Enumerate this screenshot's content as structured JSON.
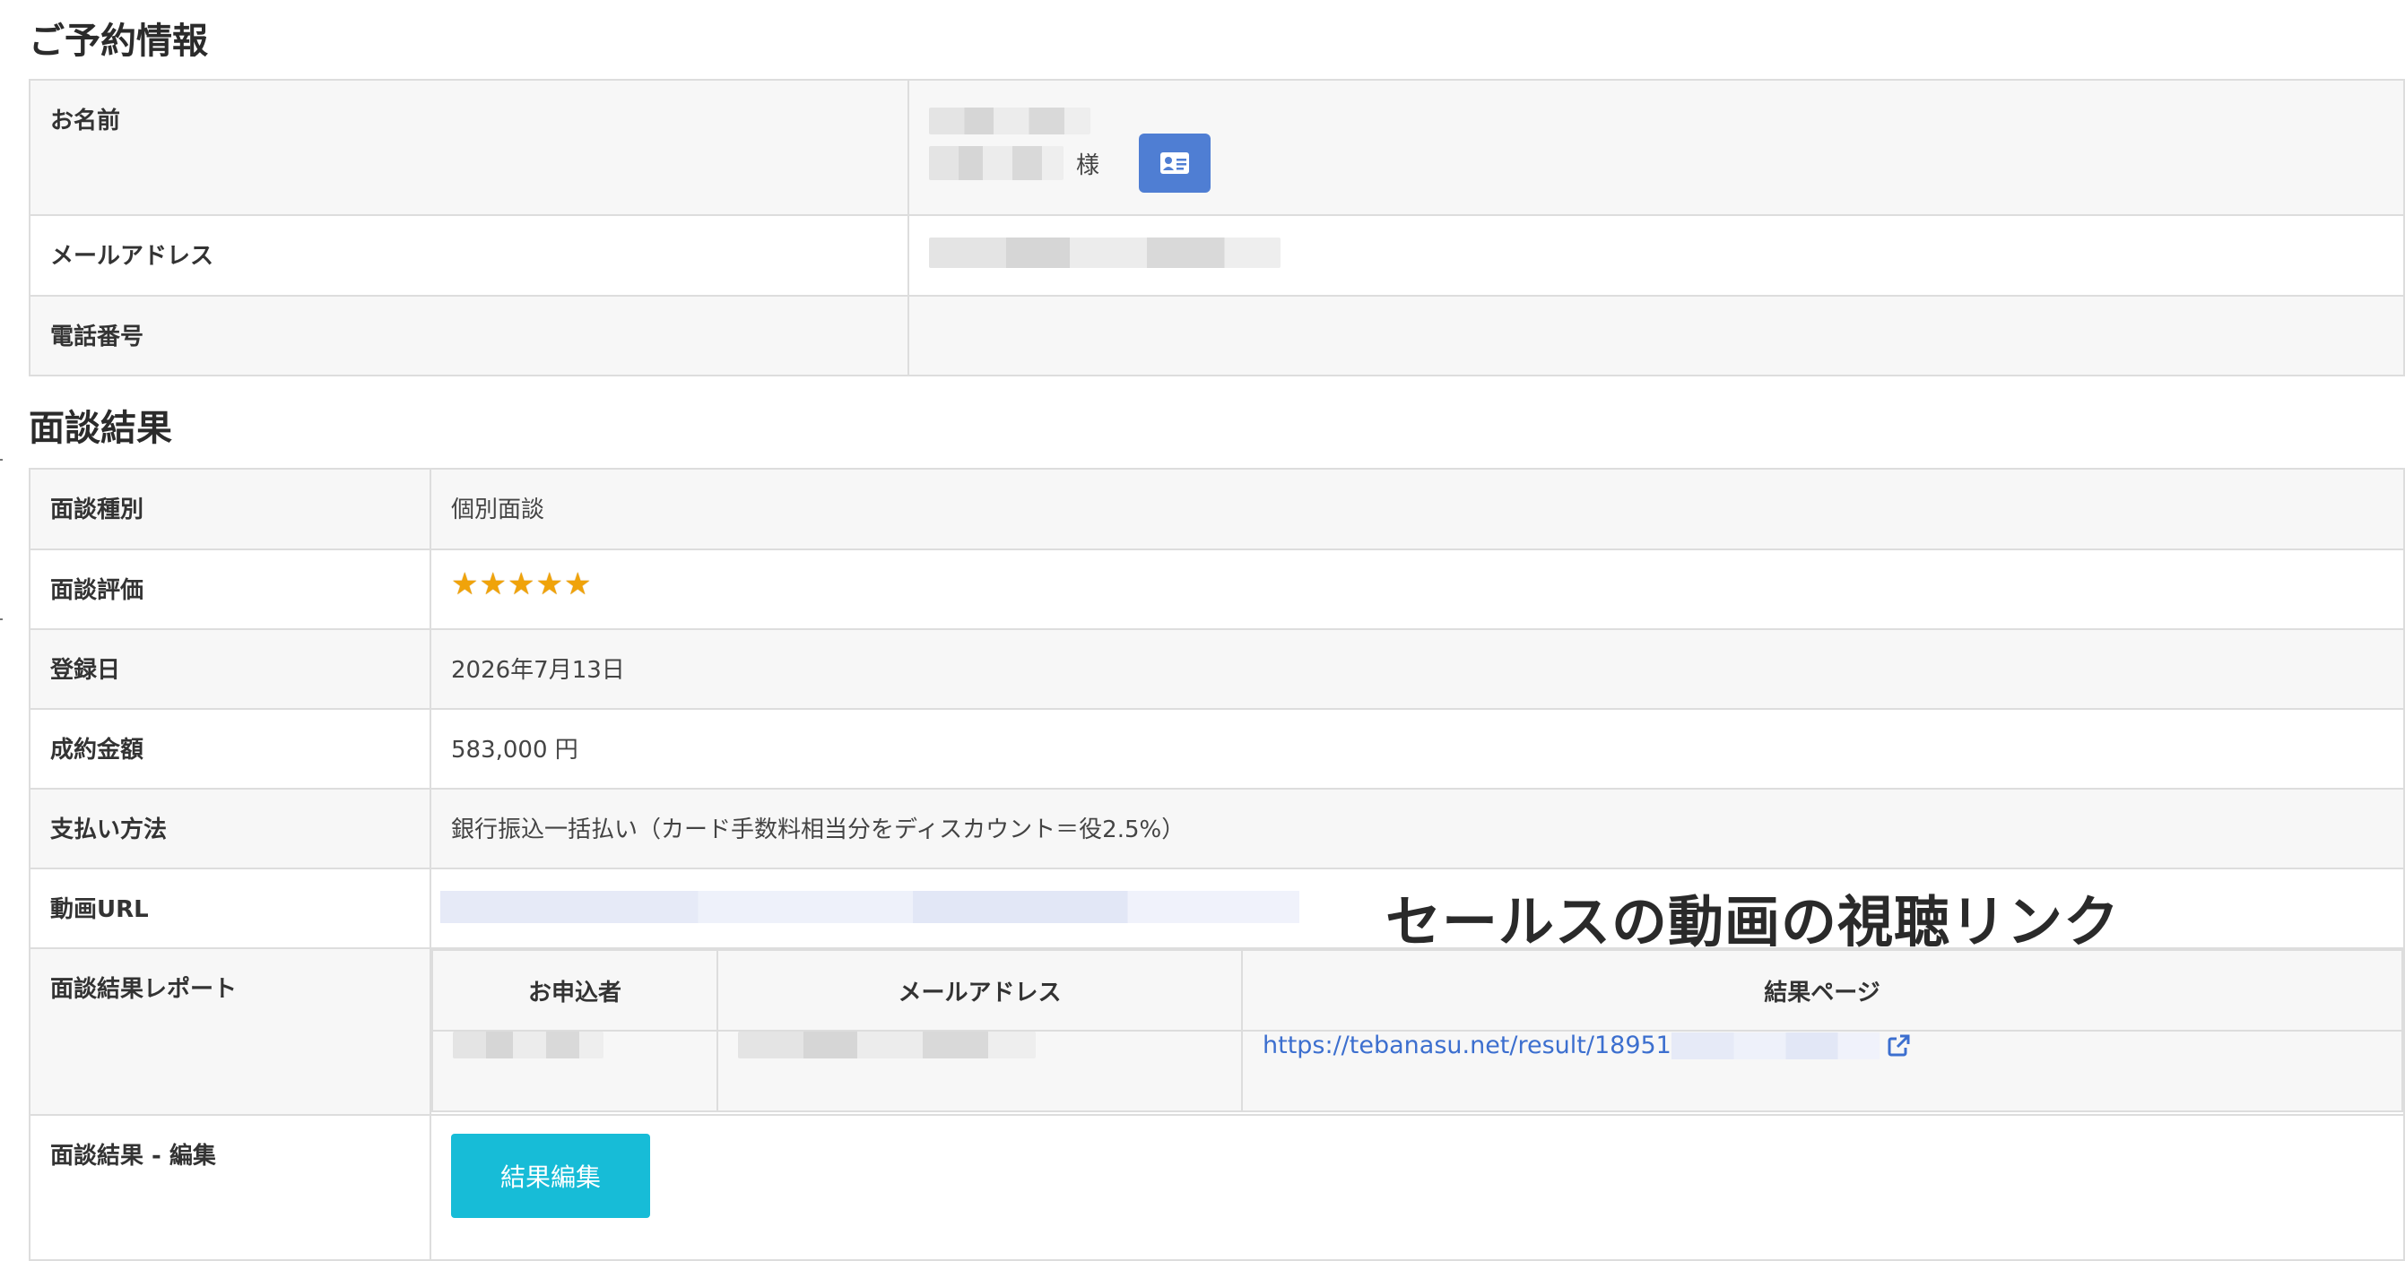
{
  "reservation": {
    "title": "ご予約情報",
    "name_label": "お名前",
    "name_suffix": "様",
    "email_label": "メールアドレス",
    "phone_label": "電話番号",
    "phone_value": ""
  },
  "result": {
    "title": "面談結果",
    "rows": {
      "type_label": "面談種別",
      "type_value": "個別面談",
      "rating_label": "面談評価",
      "rating_value": 5,
      "date_label": "登録日",
      "date_value": "2026年7月13日",
      "amount_label": "成約金額",
      "amount_value": "583,000 円",
      "payment_label": "支払い方法",
      "payment_value": "銀行振込一括払い（カード手数料相当分をディスカウント＝役2.5%）",
      "video_label": "動画URL",
      "report_label": "面談結果レポート",
      "edit_label": "面談結果 - 編集"
    },
    "report_table": {
      "headers": [
        "お申込者",
        "メールアドレス",
        "結果ページ"
      ],
      "link_text": "https://tebanasu.net/result/18951"
    },
    "edit_button": "結果編集"
  },
  "annotation": "セールスの動画の視聴リンク",
  "icons": {
    "vcard": "id-card-icon",
    "star": "star-icon",
    "external": "external-link-icon"
  },
  "colors": {
    "vcard_button": "#4f7ed3",
    "edit_button": "#17bcd7",
    "link": "#3c6fcf",
    "star": "#f0a30a"
  }
}
